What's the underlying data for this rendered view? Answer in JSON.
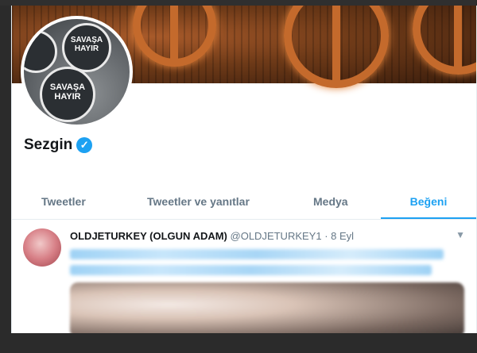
{
  "profile": {
    "name": "Sezgin",
    "verified_icon": "verified-badge-icon",
    "avatar_sign_text": [
      "SAVAŞA",
      "HAYIR"
    ]
  },
  "tabs": [
    {
      "label": "Tweetler",
      "active": false
    },
    {
      "label": "Tweetler ve yanıtlar",
      "active": false
    },
    {
      "label": "Medya",
      "active": false
    },
    {
      "label": "Beğeni",
      "active": true
    }
  ],
  "tweet": {
    "author_name": "OLDJETURKEY (OLGUN ADAM)",
    "handle": "@OLDJETURKEY1",
    "separator": "·",
    "date": "8 Eyl",
    "menu_icon": "chevron-down-icon"
  },
  "colors": {
    "accent": "#1da1f2",
    "text": "#14171a",
    "muted": "#657786"
  }
}
